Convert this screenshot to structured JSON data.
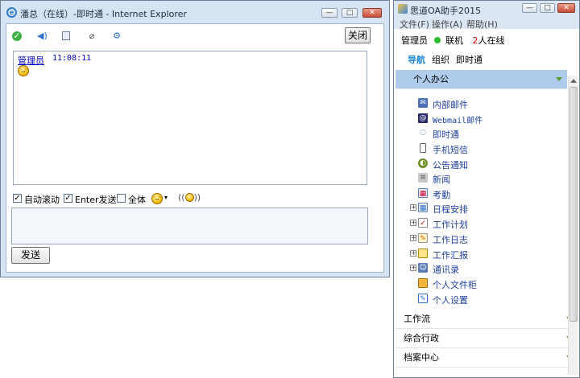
{
  "ie_window": {
    "title": "潘总（在线）-即时通 - Internet Explorer",
    "close_label": "关闭",
    "message": {
      "sender": "管理员",
      "time": "11:08:11"
    },
    "options": {
      "auto_scroll": "自动滚动",
      "enter_send": "Enter发送",
      "all": "全体"
    },
    "send_label": "发送",
    "toolbar_icons": [
      "online-status-icon",
      "sound-icon",
      "screenshot-icon",
      "attachment-icon",
      "settings-icon"
    ],
    "title_buttons": [
      "—",
      "□",
      "✕"
    ]
  },
  "oa_window": {
    "title": "思道OA助手2015",
    "menu": [
      "文件(F)",
      "操作(A)",
      "帮助(H)"
    ],
    "status": {
      "user": "管理员",
      "connection": "联机",
      "online_count": "2",
      "online_suffix": "人在线"
    },
    "nav_tabs": [
      "导航",
      "组织",
      "即时通"
    ],
    "sections": [
      "个人办公",
      "工作流",
      "综合行政",
      "档案中心"
    ],
    "tree_items": [
      "内部邮件",
      "Webmail邮件",
      "即时通",
      "手机短信",
      "公告通知",
      "新闻",
      "考勤",
      "日程安排",
      "工作计划",
      "工作日志",
      "工作汇报",
      "通讯录",
      "个人文件柜",
      "个人设置"
    ],
    "colors": {
      "accent": "#1f8ad6",
      "online_count": "#d40000",
      "section_active": "#aecbeb"
    }
  }
}
